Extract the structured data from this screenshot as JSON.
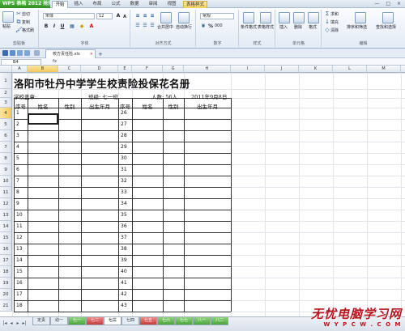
{
  "app": {
    "title": "WPS 表格 2012 抢先版"
  },
  "menu_tabs": [
    {
      "label": "开始"
    },
    {
      "label": "插入"
    },
    {
      "label": "布局"
    },
    {
      "label": "公式"
    },
    {
      "label": "数据"
    },
    {
      "label": "审阅"
    },
    {
      "label": "视图"
    },
    {
      "label": "表格样式"
    }
  ],
  "window_controls": "— □ ×",
  "ribbon": {
    "clipboard": {
      "label": "剪贴板",
      "paste": "粘贴",
      "cut": "剪切",
      "copy": "复制",
      "format_painter": "格式刷"
    },
    "font": {
      "label": "字体",
      "name": "宋体",
      "size": "12",
      "bold": "B",
      "italic": "I",
      "underline": "U",
      "grow": "A",
      "shrink": "A"
    },
    "align": {
      "label": "对齐方式",
      "merge": "合并居中",
      "wrap": "自动换行"
    },
    "number": {
      "label": "数字",
      "format": "常规",
      "percent": "%",
      "thousand": "000"
    },
    "style": {
      "label": "样式",
      "cond_format": "条件格式",
      "table_style": "表格样式"
    },
    "cells": {
      "label": "单元格",
      "insert": "插入",
      "delete": "删除",
      "format": "格式"
    },
    "edit": {
      "label": "编辑",
      "sum": "求和",
      "fill": "填充",
      "clear": "清除",
      "sort": "排序和筛选",
      "find": "查找和选择"
    }
  },
  "document_tab": {
    "title": "校方责任险.xls",
    "close": "×"
  },
  "name_box": "B4",
  "formula_icon": "fx",
  "columns": [
    "A",
    "B",
    "C",
    "D",
    "E",
    "F",
    "G",
    "H",
    "I",
    "J",
    "K",
    "L",
    "M",
    "N"
  ],
  "rows": [
    "1",
    "2",
    "3",
    "4",
    "5",
    "6",
    "7",
    "8",
    "9",
    "10",
    "11",
    "12",
    "13",
    "14",
    "15",
    "16",
    "17",
    "18",
    "19",
    "20",
    "21"
  ],
  "sheet_content": {
    "title": "洛阳市牡丹中学学生校责险投保花名册",
    "school": "学校盖章:",
    "class": "班级: 七一班",
    "count": "人数: 56人",
    "date": "2011年9月8日",
    "headers_left": [
      "序号",
      "姓名",
      "性别",
      "出生年月"
    ],
    "headers_right": [
      "序号",
      "姓名",
      "性别",
      "出生年月"
    ],
    "left_numbers": [
      "1",
      "2",
      "3",
      "4",
      "5",
      "6",
      "7",
      "8",
      "9",
      "10",
      "11",
      "12",
      "13",
      "14",
      "15",
      "16",
      "17",
      "18"
    ],
    "right_numbers": [
      "26",
      "27",
      "28",
      "29",
      "30",
      "31",
      "32",
      "33",
      "34",
      "35",
      "36",
      "37",
      "38",
      "39",
      "40",
      "41",
      "42",
      "43"
    ]
  },
  "sheet_tabs": [
    {
      "label": "定责"
    },
    {
      "label": "幼一"
    },
    {
      "label": "七一"
    },
    {
      "label": "七二"
    },
    {
      "label": "七三"
    },
    {
      "label": "七四"
    },
    {
      "label": "七五"
    },
    {
      "label": "七六"
    },
    {
      "label": "七七"
    },
    {
      "label": "八一"
    },
    {
      "label": "八二"
    }
  ],
  "watermark": {
    "cn": "无忧电脑学习网",
    "url": "W Y P C W . C O M"
  }
}
